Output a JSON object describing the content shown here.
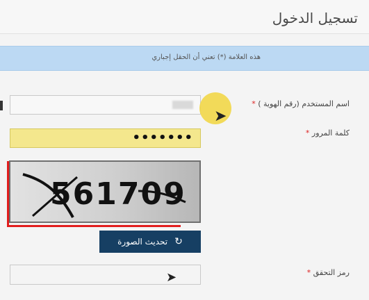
{
  "page_title": "تسجيل الدخول",
  "notice_text": "هذه العلامة (*) تعني أن الحقل إجباري",
  "fields": {
    "username_label": "اسم المستخدم (رقم الهوية )",
    "password_label": "كلمة المرور",
    "password_value": "•••••••",
    "verification_label": "رمز التحقق"
  },
  "required_marker": "*",
  "captcha": {
    "text": "561709"
  },
  "buttons": {
    "refresh_label": "تحديث الصورة"
  },
  "colors": {
    "notice_bg": "#bcd9f3",
    "password_bg": "#f4e78d",
    "button_bg": "#163f63",
    "annotation_red": "#e21d1d",
    "cursor_highlight": "#f1d643"
  },
  "icons": {
    "refresh": "refresh-icon",
    "cursor": "pointer-icon"
  }
}
